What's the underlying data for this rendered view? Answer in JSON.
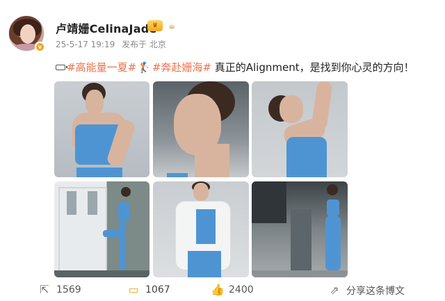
{
  "post": {
    "author": "卢靖姗CelinaJade",
    "date": "25-5-17 19:19",
    "location": "发布于 北京",
    "tag1": "#高能量一夏#",
    "tag2": "#奔赴姗海#",
    "text": "真正的Alignment，是找到你心灵的方向！"
  },
  "badges": {
    "verified": "v"
  },
  "actions": {
    "repost_count": "1569",
    "comment_count": "1067",
    "like_count": "2400",
    "share_label": "分享这条博文"
  },
  "icons": [
    "avatar",
    "verified-icon",
    "crown-icon",
    "cup-icon",
    "battery-icon",
    "figure-icon",
    "repost-icon",
    "comment-icon",
    "like-icon",
    "share-icon"
  ],
  "colors": {
    "tag": "#eb7350",
    "accent": "#f4a420"
  }
}
